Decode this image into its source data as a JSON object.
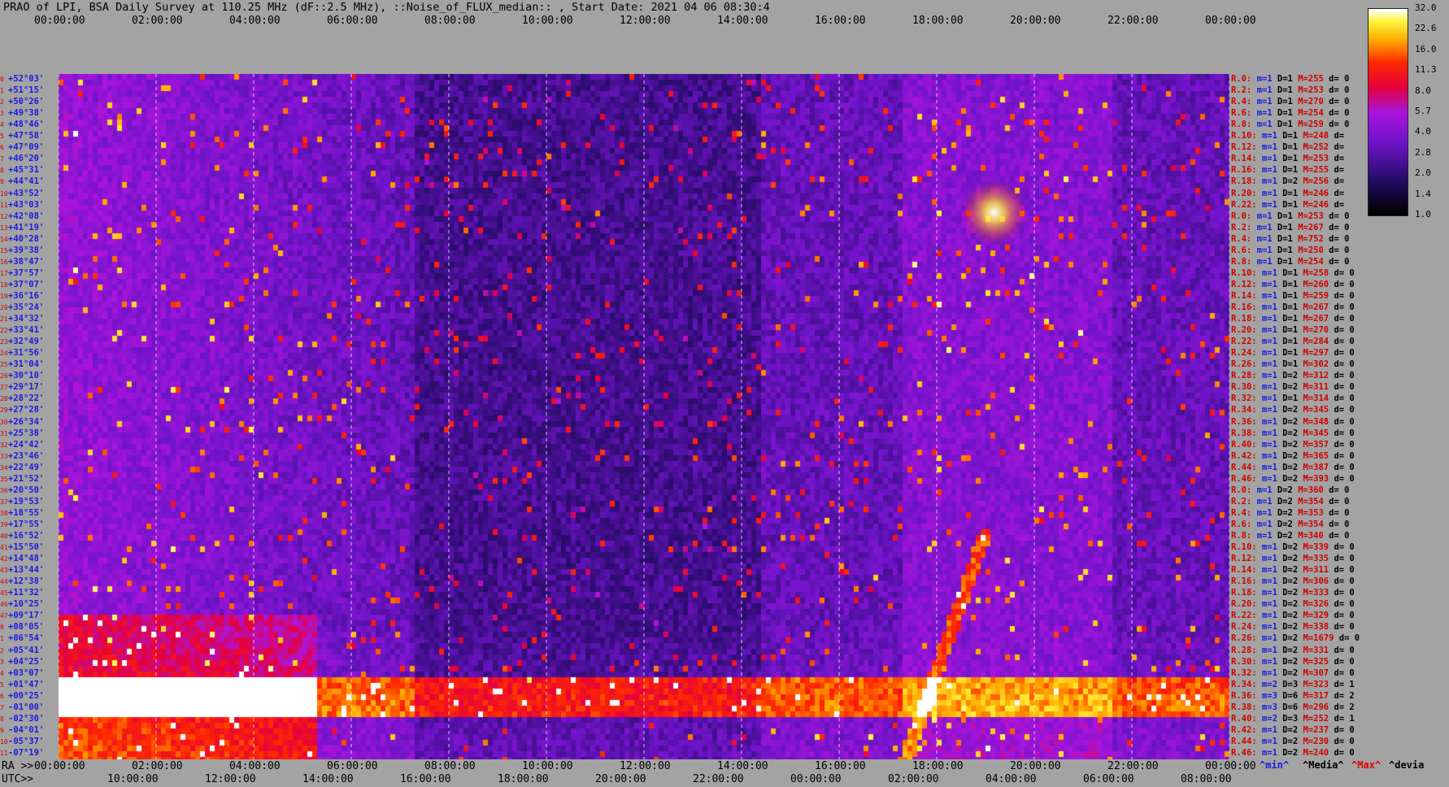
{
  "title": "PRAO of LPI, BSA Daily Survey at 110.25 MHz (dF::2.5 MHz), ::Noise_of_FLUX_median:: , Start Date: 2021 04 06 08:30:4",
  "top_axis_labels": [
    "00:00:00",
    "02:00:00",
    "04:00:00",
    "06:00:00",
    "08:00:00",
    "10:00:00",
    "12:00:00",
    "14:00:00",
    "16:00:00",
    "18:00:00",
    "20:00:00",
    "22:00:00",
    "00:00:00"
  ],
  "bottom_ra_prefix": "RA >>",
  "bottom_ra_labels": [
    "00:00:00",
    "02:00:00",
    "04:00:00",
    "06:00:00",
    "08:00:00",
    "10:00:00",
    "12:00:00",
    "14:00:00",
    "16:00:00",
    "18:00:00",
    "20:00:00",
    "22:00:00",
    "00:00:00"
  ],
  "bottom_utc_prefix": "UTC>>",
  "bottom_utc_labels": [
    "10:00:00",
    "12:00:00",
    "14:00:00",
    "16:00:00",
    "18:00:00",
    "20:00:00",
    "22:00:00",
    "00:00:00",
    "02:00:00",
    "04:00:00",
    "06:00:00",
    "08:00:00"
  ],
  "colorbar": {
    "ticks": [
      "32.0",
      "22.6",
      "16.0",
      "11.3",
      "8.0",
      "5.7",
      "4.0",
      "2.8",
      "2.0",
      "1.4",
      "1.0"
    ]
  },
  "footer": {
    "min": "^min^",
    "median": "^Media^",
    "max": "^Max^",
    "devia": "^devia"
  },
  "colors": {
    "background": "#a3a3a3",
    "label_red": "#d00000",
    "label_blue": "#1a1ae0"
  },
  "chart_data": {
    "type": "heatmap",
    "title": "PRAO of LPI, BSA Daily Survey at 110.25 MHz (dF::2.5 MHz), ::Noise_of_FLUX_median:: , Start Date: 2021 04 06 08:30:4",
    "x_axis": "RA / UTC time over 24 hours",
    "y_axis_declinations": [
      "+52°03'",
      "+51°15'",
      "+50°26'",
      "+49°38'",
      "+48°46'",
      "+47°58'",
      "+47°09'",
      "+46°20'",
      "+45°31'",
      "+44°41'",
      "+43°52'",
      "+43°03'",
      "+42°08'",
      "+41°19'",
      "+40°28'",
      "+39°38'",
      "+38°47'",
      "+37°57'",
      "+37°07'",
      "+36°16'",
      "+35°24'",
      "+34°32'",
      "+33°41'",
      "+32°49'",
      "+31°56'",
      "+31°04'",
      "+30°10'",
      "+29°17'",
      "+28°22'",
      "+27°28'",
      "+26°34'",
      "+25°38'",
      "+24°42'",
      "+23°46'",
      "+22°49'",
      "+21°52'",
      "+20°50'",
      "+19°53'",
      "+18°55'",
      "+17°55'",
      "+16°52'",
      "+15°50'",
      "+14°48'",
      "+13°44'",
      "+12°38'",
      "+11°32'",
      "+10°25'",
      "+09°17'",
      "+08°05'",
      "+06°54'",
      "+05°41'",
      "+04°25'",
      "+03°07'",
      "+01°47'",
      "+00°25'",
      "-01°00'",
      "-02°30'",
      "-04°01'",
      "-05°37'",
      "-07°19'"
    ],
    "colorscale": {
      "min": 1.0,
      "max": 32.0,
      "scale": "log2"
    },
    "features": [
      "bright broadband band near declination -01° across the day",
      "strong emission at low declinations from RA 00h to 06h",
      "bright point source near RA 20h, Dec +41°",
      "diagonal bright streak near RA 19h from Dec +16° down to -07°"
    ],
    "right_labels": [
      "R.0: m=1 D=1 M=255 d= 0",
      "R.2: m=1 D=1 M=253 d= 0",
      "R.4: m=1 D=1 M=270 d= 0",
      "R.6: m=1 D=1 M=254 d= 0",
      "R.8: m=1 D=1 M=259 d= 0",
      "R.10: m=1 D=1 M=248 d=",
      "R.12: m=1 D=1 M=252 d=",
      "R.14: m=1 D=1 M=253 d=",
      "R.16: m=1 D=1 M=255 d=",
      "R.18: m=1 D=2 M=256 d=",
      "R.20: m=1 D=1 M=246 d=",
      "R.22: m=1 D=1 M=246 d=",
      "R.0: m=1 D=1 M=253 d= 0",
      "R.2: m=1 D=1 M=267 d= 0",
      "R.4: m=1 D=1 M=752 d= 0",
      "R.6: m=1 D=1 M=250 d= 0",
      "R.8: m=1 D=1 M=254 d= 0",
      "R.10: m=1 D=1 M=258 d= 0",
      "R.12: m=1 D=1 M=260 d= 0",
      "R.14: m=1 D=1 M=259 d= 0",
      "R.16: m=1 D=1 M=267 d= 0",
      "R.18: m=1 D=1 M=267 d= 0",
      "R.20: m=1 D=1 M=270 d= 0",
      "R.22: m=1 D=1 M=284 d= 0",
      "R.24: m=1 D=1 M=297 d= 0",
      "R.26: m=1 D=1 M=302 d= 0",
      "R.28: m=1 D=2 M=312 d= 0",
      "R.30: m=1 D=2 M=311 d= 0",
      "R.32: m=1 D=1 M=314 d= 0",
      "R.34: m=1 D=2 M=345 d= 0",
      "R.36: m=1 D=2 M=348 d= 0",
      "R.38: m=1 D=2 M=345 d= 0",
      "R.40: m=1 D=2 M=357 d= 0",
      "R.42: m=1 D=2 M=365 d= 0",
      "R.44: m=1 D=2 M=387 d= 0",
      "R.46: m=1 D=2 M=393 d= 0",
      "R.0: m=1 D=2 M=360 d= 0",
      "R.2: m=1 D=2 M=354 d= 0",
      "R.4: m=1 D=2 M=353 d= 0",
      "R.6: m=1 D=2 M=354 d= 0",
      "R.8: m=1 D=2 M=340 d= 0",
      "R.10: m=1 D=2 M=339 d= 0",
      "R.12: m=1 D=2 M=335 d= 0",
      "R.14: m=1 D=2 M=311 d= 0",
      "R.16: m=1 D=2 M=306 d= 0",
      "R.18: m=1 D=2 M=333 d= 0",
      "R.20: m=1 D=2 M=326 d= 0",
      "R.22: m=1 D=2 M=329 d= 0",
      "R.24: m=1 D=2 M=338 d= 0",
      "R.26: m=1 D=2 M=1679 d= 0",
      "R.28: m=1 D=2 M=331 d= 0",
      "R.30: m=1 D=2 M=325 d= 0",
      "R.32: m=1 D=2 M=307 d= 0",
      "R.34: m=2 D=3 M=323 d= 1",
      "R.36: m=3 D=6 M=317 d= 2",
      "R.38: m=3 D=6 M=296 d= 2",
      "R.40: m=2 D=3 M=252 d= 1",
      "R.42: m=1 D=2 M=237 d= 0",
      "R.44: m=1 D=2 M=230 d= 0",
      "R.46: m=1 D=2 M=240 d= 0"
    ]
  }
}
